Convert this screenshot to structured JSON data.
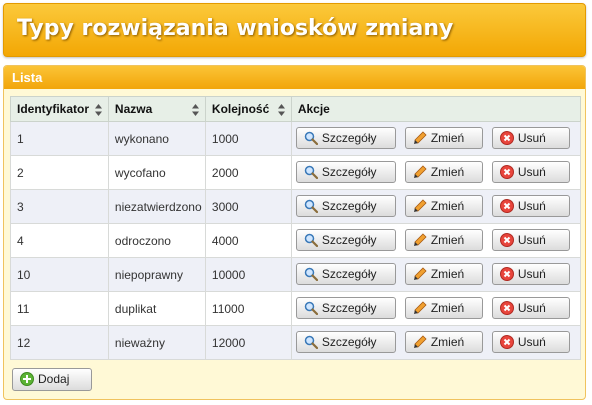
{
  "page_title": "Typy rozwiązania wniosków zmiany",
  "panel_title": "Lista",
  "columns": {
    "id": "Identyfikator",
    "name": "Nazwa",
    "order": "Kolejność",
    "actions": "Akcje"
  },
  "rows": [
    {
      "id": "1",
      "name": "wykonano",
      "order": "1000"
    },
    {
      "id": "2",
      "name": "wycofano",
      "order": "2000"
    },
    {
      "id": "3",
      "name": "niezatwierdzono",
      "order": "3000"
    },
    {
      "id": "4",
      "name": "odroczono",
      "order": "4000"
    },
    {
      "id": "10",
      "name": "niepoprawny",
      "order": "10000"
    },
    {
      "id": "11",
      "name": "duplikat",
      "order": "11000"
    },
    {
      "id": "12",
      "name": "nieważny",
      "order": "12000"
    }
  ],
  "buttons": {
    "details": "Szczegóły",
    "edit": "Zmień",
    "delete": "Usuń",
    "add": "Dodaj"
  },
  "icons": {
    "details": "magnifier-icon",
    "edit": "pencil-icon",
    "delete": "delete-circle-icon",
    "add": "add-circle-icon",
    "sort": "sort-arrows-icon"
  }
}
